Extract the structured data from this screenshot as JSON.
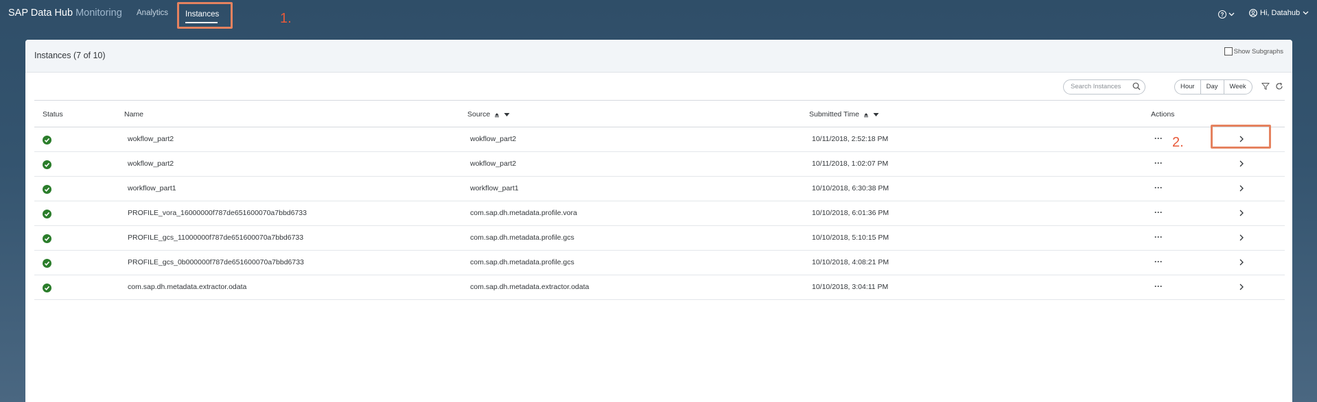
{
  "header": {
    "brand_main": "SAP Data Hub",
    "brand_sub": "Monitoring",
    "nav": [
      {
        "label": "Analytics"
      },
      {
        "label": "Instances"
      }
    ],
    "user_label": "Hi, Datahub"
  },
  "annotations": {
    "step1": "1.",
    "step2": "2."
  },
  "panel": {
    "title": "Instances (7 of 10)",
    "show_subgraphs": "Show Subgraphs",
    "search_placeholder": "Search Instances",
    "ranges": [
      "Hour",
      "Day",
      "Week"
    ]
  },
  "table": {
    "columns": {
      "status": "Status",
      "name": "Name",
      "source": "Source",
      "submitted": "Submitted Time",
      "actions": "Actions"
    },
    "rows": [
      {
        "name": "wokflow_part2",
        "source": "wokflow_part2",
        "time": "10/11/2018, 2:52:18 PM"
      },
      {
        "name": "wokflow_part2",
        "source": "wokflow_part2",
        "time": "10/11/2018, 1:02:07 PM"
      },
      {
        "name": "workflow_part1",
        "source": "workflow_part1",
        "time": "10/10/2018, 6:30:38 PM"
      },
      {
        "name": "PROFILE_vora_16000000f787de651600070a7bbd6733",
        "source": "com.sap.dh.metadata.profile.vora",
        "time": "10/10/2018, 6:01:36 PM"
      },
      {
        "name": "PROFILE_gcs_11000000f787de651600070a7bbd6733",
        "source": "com.sap.dh.metadata.profile.gcs",
        "time": "10/10/2018, 5:10:15 PM"
      },
      {
        "name": "PROFILE_gcs_0b000000f787de651600070a7bbd6733",
        "source": "com.sap.dh.metadata.profile.gcs",
        "time": "10/10/2018, 4:08:21 PM"
      },
      {
        "name": "com.sap.dh.metadata.extractor.odata",
        "source": "com.sap.dh.metadata.extractor.odata",
        "time": "10/10/2018, 3:04:11 PM"
      }
    ],
    "row_action_label": "···"
  },
  "colors": {
    "accent_highlight": "#e5825f",
    "annotation": "#e85a3a",
    "success": "#2b7d2b",
    "shell": "#2f4e68"
  }
}
